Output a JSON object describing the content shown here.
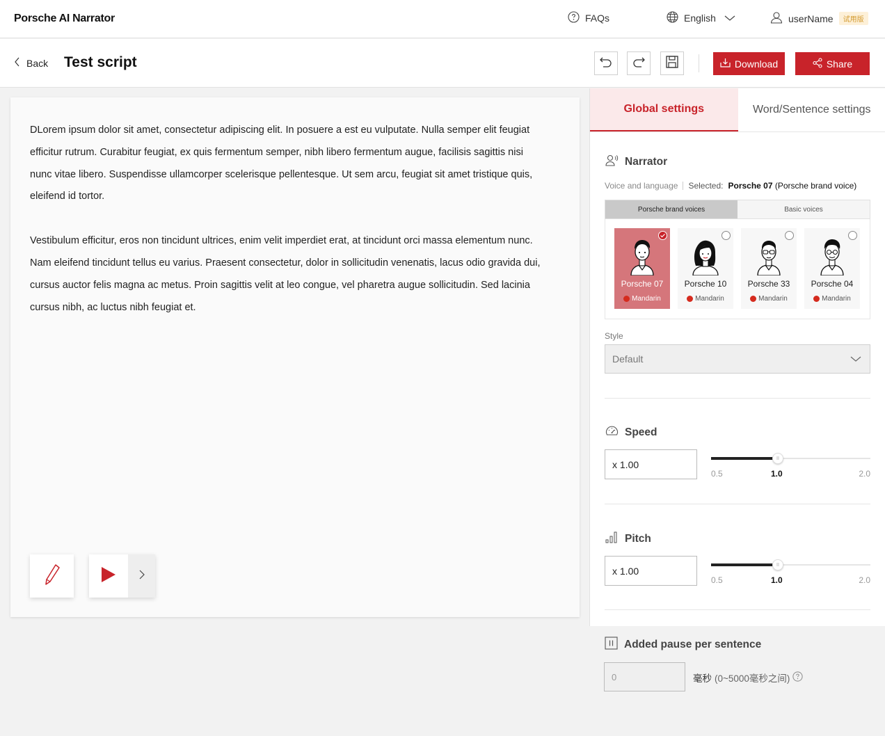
{
  "app": {
    "brand": "Porsche AI Narrator"
  },
  "topnav": {
    "faqs": "FAQs",
    "language": "English",
    "username": "userName",
    "trial_badge": "试用版"
  },
  "header": {
    "back_label": "Back",
    "title": "Test script",
    "download_label": "Download",
    "share_label": "Share"
  },
  "editor": {
    "paragraphs": [
      "DLorem ipsum dolor sit amet, consectetur adipiscing elit. In posuere a est eu vulputate. Nulla semper elit feugiat efficitur rutrum. Curabitur feugiat, ex quis fermentum semper, nibh libero fermentum augue, facilisis sagittis nisi nunc vitae libero. Suspendisse ullamcorper scelerisque pellentesque. Ut sem arcu, feugiat sit amet tristique quis, eleifend id tortor.",
      "Vestibulum efficitur, eros non tincidunt ultrices, enim velit imperdiet erat, at tincidunt orci massa elementum nunc. Nam eleifend tincidunt tellus eu varius. Praesent consectetur, dolor in sollicitudin venenatis, lacus odio gravida dui, cursus auctor felis magna ac metus. Proin sagittis velit at leo congue, vel pharetra augue sollicitudin. Sed lacinia cursus nibh, ac luctus nibh feugiat et."
    ]
  },
  "panel": {
    "tabs": [
      {
        "label": "Global settings",
        "active": true
      },
      {
        "label": "Word/Sentence settings",
        "active": false
      }
    ],
    "narrator": {
      "title": "Narrator",
      "voice_language_label": "Voice and language",
      "selected_label": "Selected:",
      "selected_value": "Porsche 07",
      "selected_note": "(Porsche brand voice)",
      "voice_tabs": [
        {
          "label": "Porsche brand voices",
          "active": true
        },
        {
          "label": "Basic voices",
          "active": false
        }
      ],
      "voices": [
        {
          "name": "Porsche 07",
          "language": "Mandarin",
          "selected": true
        },
        {
          "name": "Porsche 10",
          "language": "Mandarin",
          "selected": false
        },
        {
          "name": "Porsche 33",
          "language": "Mandarin",
          "selected": false
        },
        {
          "name": "Porsche 04",
          "language": "Mandarin",
          "selected": false
        }
      ]
    },
    "style": {
      "label": "Style",
      "value": "Default"
    },
    "speed": {
      "title": "Speed",
      "value": "x 1.00",
      "min": "0.5",
      "mid": "1.0",
      "max": "2.0",
      "level": 1.0
    },
    "pitch": {
      "title": "Pitch",
      "value": "x 1.00",
      "min": "0.5",
      "mid": "1.0",
      "max": "2.0",
      "level": 1.0
    }
  },
  "pause": {
    "title": "Added pause per sentence",
    "placeholder": "0",
    "unit": "毫秒",
    "range": "(0~5000毫秒之间)"
  },
  "colors": {
    "accent": "#c8232a",
    "selected_card": "#d5767b",
    "tab_active_bg": "#fbe9ea"
  }
}
